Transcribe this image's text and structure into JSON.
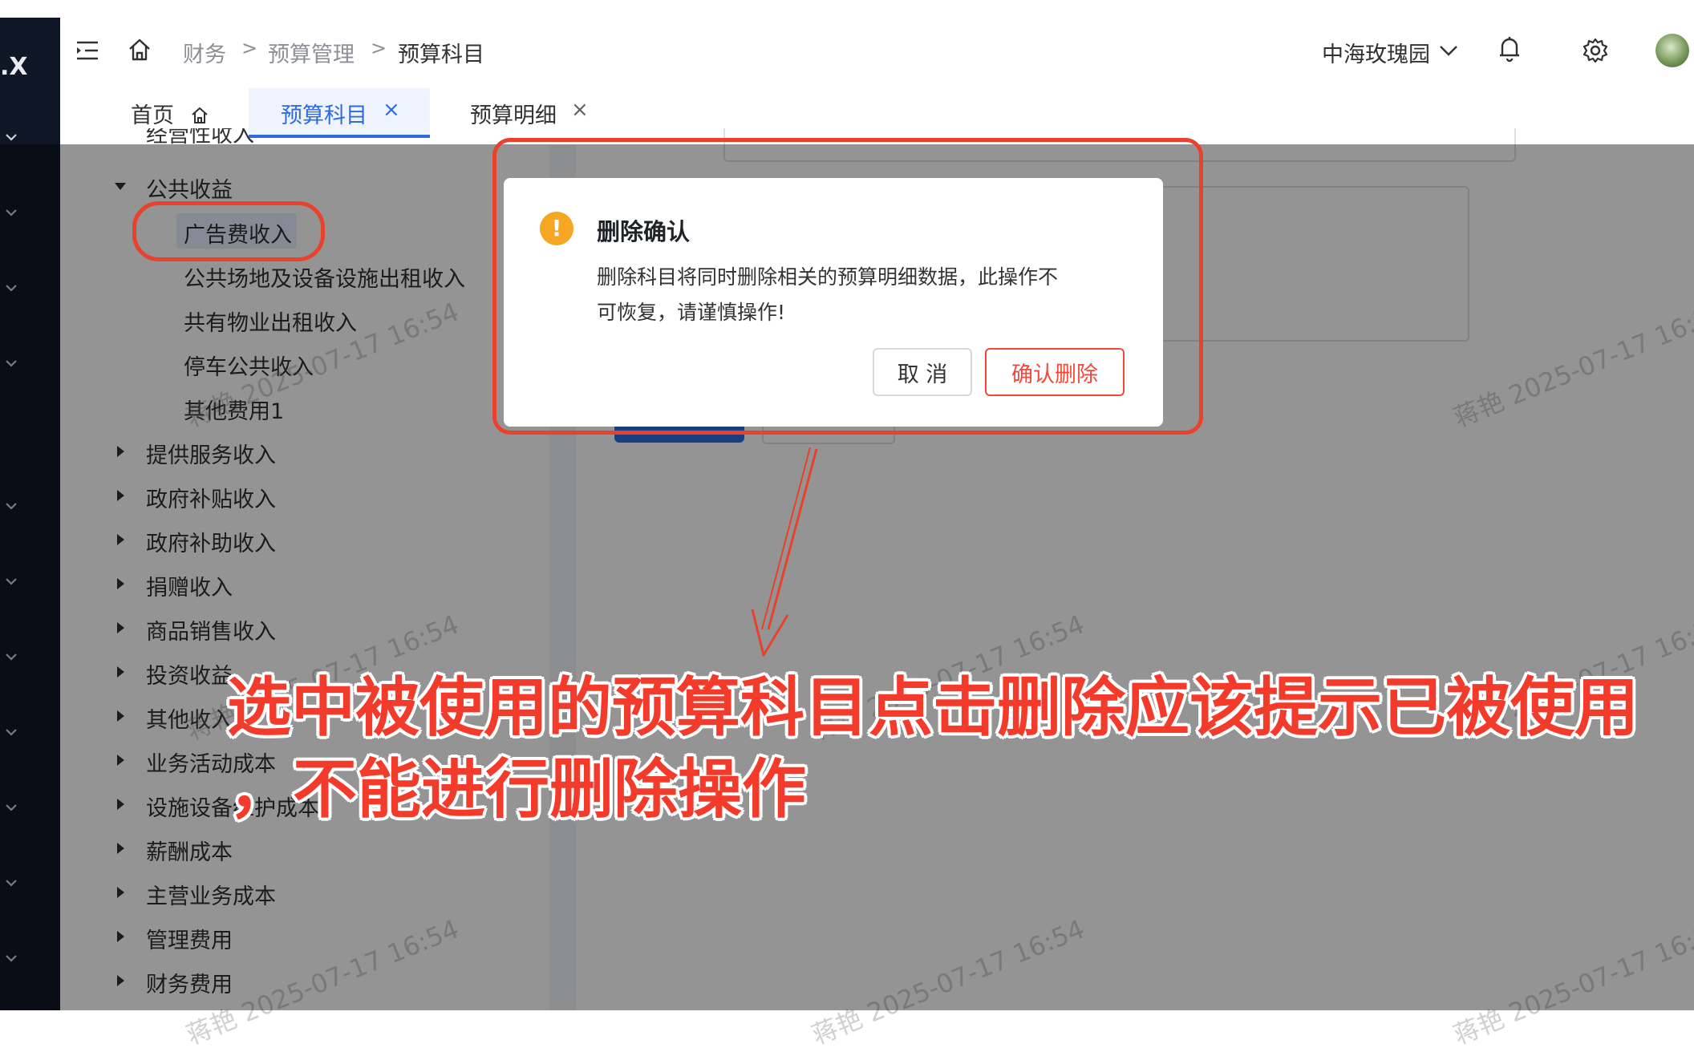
{
  "app": {
    "logo_fragment": ".X"
  },
  "header": {
    "breadcrumb": [
      "财务",
      "预算管理",
      "预算科目"
    ],
    "separator": ">",
    "community": "中海玫瑰园"
  },
  "tabs": [
    {
      "label": "首页",
      "active": false
    },
    {
      "label": "预算科目",
      "active": true
    },
    {
      "label": "预算明细",
      "active": false
    }
  ],
  "tree": {
    "partial_top": "经营性收入",
    "expanded_group": "公共收益",
    "children": [
      "广告费收入",
      "公共场地及设备设施出租收入",
      "共有物业出租收入",
      "停车公共收入",
      "其他费用1"
    ],
    "groups": [
      "提供服务收入",
      "政府补贴收入",
      "政府补助收入",
      "捐赠收入",
      "商品销售收入",
      "投资收益",
      "其他收入",
      "业务活动成本",
      "设施设备维护成本",
      "薪酬成本",
      "主营业务成本",
      "管理费用",
      "财务费用"
    ]
  },
  "dialog": {
    "title": "删除确认",
    "message_line1": "删除科目将同时删除相关的预算明细数据，此操作不",
    "message_line2": "可恢复，请谨慎操作!",
    "cancel_label": "取 消",
    "confirm_label": "确认删除"
  },
  "annotation": {
    "line1": "选中被使用的预算科目点击删除应该提示已被使用",
    "line2": "，不能进行删除操作"
  },
  "watermark": "蒋艳 2025-07-17 16:54",
  "colors": {
    "sidebar": "#0f1726",
    "accent": "#2f6bdc",
    "danger": "#f0493a",
    "warning": "#f5a623",
    "annotation": "#f23b2a"
  }
}
